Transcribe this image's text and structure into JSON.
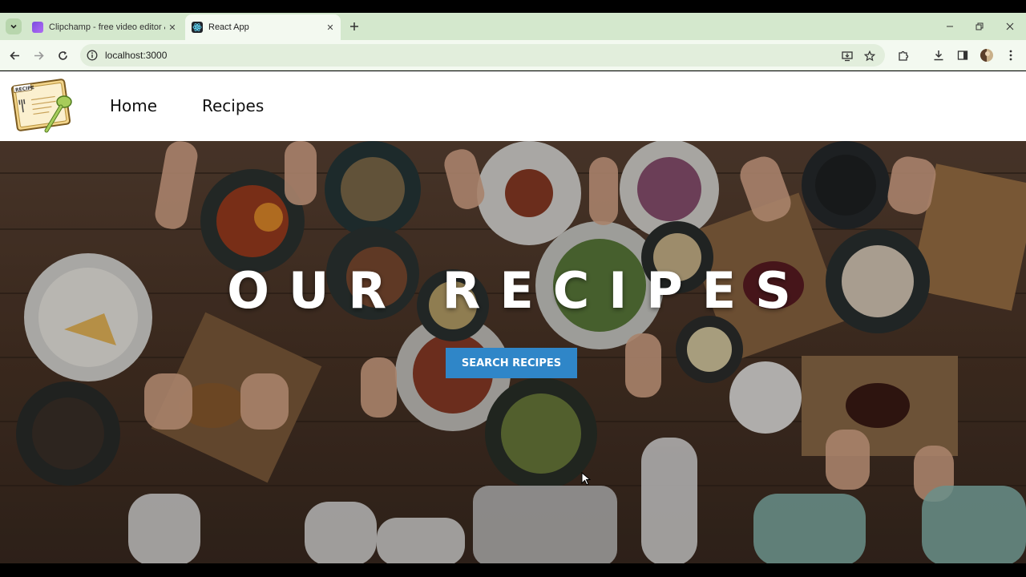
{
  "browser": {
    "tabs": [
      {
        "title": "Clipchamp - free video editor & ...",
        "active": false,
        "favicon": "clipchamp-icon"
      },
      {
        "title": "React App",
        "active": true,
        "favicon": "react-icon"
      }
    ],
    "url": "localhost:3000"
  },
  "site": {
    "logo_text": "RECIPE",
    "nav": [
      {
        "label": "Home"
      },
      {
        "label": "Recipes"
      }
    ]
  },
  "hero": {
    "title": "OUR RECIPES",
    "button_label": "SEARCH RECIPES"
  },
  "colors": {
    "tabstrip": "#d4e8cd",
    "toolbar": "#f3f9f0",
    "omnibox": "#e2eedc",
    "button_blue": "#2f86c8",
    "table_wood": "#4a3426"
  }
}
